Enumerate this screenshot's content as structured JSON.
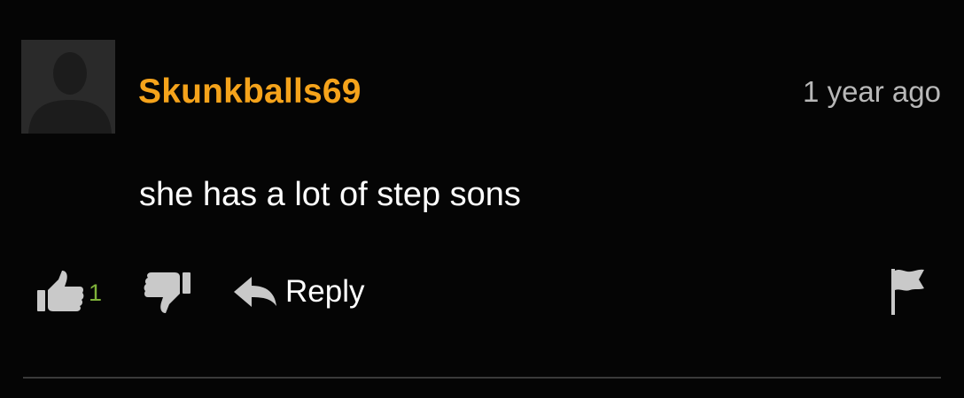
{
  "comment": {
    "username": "Skunkballs69",
    "timestamp": "1 year ago",
    "text": "she has a lot of step sons",
    "likes": "1",
    "reply_label": "Reply",
    "username_color": "#f5a31b",
    "like_count_color": "#7fb23a"
  },
  "icons": {
    "avatar": "default-user-silhouette-icon",
    "like": "thumbs-up-icon",
    "dislike": "thumbs-down-icon",
    "reply": "reply-arrow-icon",
    "report": "flag-icon"
  }
}
